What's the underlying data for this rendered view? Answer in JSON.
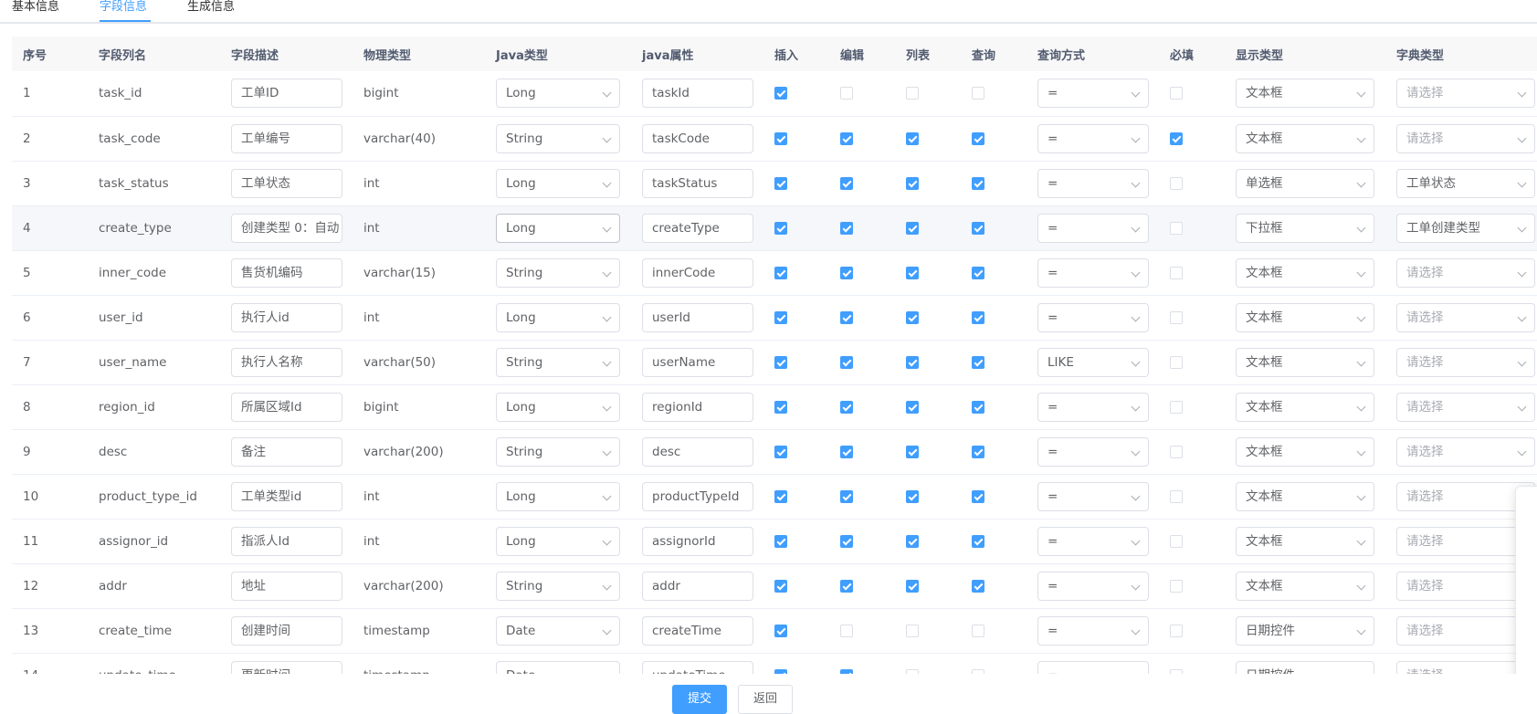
{
  "tabs": [
    "基本信息",
    "字段信息",
    "生成信息"
  ],
  "columns": [
    "序号",
    "字段列名",
    "字段描述",
    "物理类型",
    "Java类型",
    "java属性",
    "插入",
    "编辑",
    "列表",
    "查询",
    "查询方式",
    "必填",
    "显示类型",
    "字典类型"
  ],
  "dict_placeholder": "请选择",
  "rows": [
    {
      "no": "1",
      "col": "task_id",
      "desc": "工单ID",
      "ptype": "bigint",
      "jtype": "Long",
      "jprop": "taskId",
      "ins": true,
      "edit": false,
      "list": false,
      "query": false,
      "qtype": "=",
      "req": false,
      "html": "文本框",
      "dict": ""
    },
    {
      "no": "2",
      "col": "task_code",
      "desc": "工单编号",
      "ptype": "varchar(40)",
      "jtype": "String",
      "jprop": "taskCode",
      "ins": true,
      "edit": true,
      "list": true,
      "query": true,
      "qtype": "=",
      "req": true,
      "html": "文本框",
      "dict": ""
    },
    {
      "no": "3",
      "col": "task_status",
      "desc": "工单状态",
      "ptype": "int",
      "jtype": "Long",
      "jprop": "taskStatus",
      "ins": true,
      "edit": true,
      "list": true,
      "query": true,
      "qtype": "=",
      "req": false,
      "html": "单选框",
      "dict": "工单状态"
    },
    {
      "no": "4",
      "col": "create_type",
      "desc": "创建类型 0：自动",
      "ptype": "int",
      "jtype": "Long",
      "jprop": "createType",
      "ins": true,
      "edit": true,
      "list": true,
      "query": true,
      "qtype": "=",
      "req": false,
      "html": "下拉框",
      "dict": "工单创建类型"
    },
    {
      "no": "5",
      "col": "inner_code",
      "desc": "售货机编码",
      "ptype": "varchar(15)",
      "jtype": "String",
      "jprop": "innerCode",
      "ins": true,
      "edit": true,
      "list": true,
      "query": true,
      "qtype": "=",
      "req": false,
      "html": "文本框",
      "dict": ""
    },
    {
      "no": "6",
      "col": "user_id",
      "desc": "执行人id",
      "ptype": "int",
      "jtype": "Long",
      "jprop": "userId",
      "ins": true,
      "edit": true,
      "list": true,
      "query": true,
      "qtype": "=",
      "req": false,
      "html": "文本框",
      "dict": ""
    },
    {
      "no": "7",
      "col": "user_name",
      "desc": "执行人名称",
      "ptype": "varchar(50)",
      "jtype": "String",
      "jprop": "userName",
      "ins": true,
      "edit": true,
      "list": true,
      "query": true,
      "qtype": "LIKE",
      "req": false,
      "html": "文本框",
      "dict": ""
    },
    {
      "no": "8",
      "col": "region_id",
      "desc": "所属区域Id",
      "ptype": "bigint",
      "jtype": "Long",
      "jprop": "regionId",
      "ins": true,
      "edit": true,
      "list": true,
      "query": true,
      "qtype": "=",
      "req": false,
      "html": "文本框",
      "dict": ""
    },
    {
      "no": "9",
      "col": "desc",
      "desc": "备注",
      "ptype": "varchar(200)",
      "jtype": "String",
      "jprop": "desc",
      "ins": true,
      "edit": true,
      "list": true,
      "query": true,
      "qtype": "=",
      "req": false,
      "html": "文本框",
      "dict": ""
    },
    {
      "no": "10",
      "col": "product_type_id",
      "desc": "工单类型id",
      "ptype": "int",
      "jtype": "Long",
      "jprop": "productTypeId",
      "ins": true,
      "edit": true,
      "list": true,
      "query": true,
      "qtype": "=",
      "req": false,
      "html": "文本框",
      "dict": ""
    },
    {
      "no": "11",
      "col": "assignor_id",
      "desc": "指派人Id",
      "ptype": "int",
      "jtype": "Long",
      "jprop": "assignorId",
      "ins": true,
      "edit": true,
      "list": true,
      "query": true,
      "qtype": "=",
      "req": false,
      "html": "文本框",
      "dict": ""
    },
    {
      "no": "12",
      "col": "addr",
      "desc": "地址",
      "ptype": "varchar(200)",
      "jtype": "String",
      "jprop": "addr",
      "ins": true,
      "edit": true,
      "list": true,
      "query": true,
      "qtype": "=",
      "req": false,
      "html": "文本框",
      "dict": ""
    },
    {
      "no": "13",
      "col": "create_time",
      "desc": "创建时间",
      "ptype": "timestamp",
      "jtype": "Date",
      "jprop": "createTime",
      "ins": true,
      "edit": false,
      "list": false,
      "query": false,
      "qtype": "=",
      "req": false,
      "html": "日期控件",
      "dict": ""
    },
    {
      "no": "14",
      "col": "update_time",
      "desc": "更新时间",
      "ptype": "timestamp",
      "jtype": "Date",
      "jprop": "updateTime",
      "ins": true,
      "edit": true,
      "list": false,
      "query": false,
      "qtype": "=",
      "req": false,
      "html": "日期控件",
      "dict": ""
    }
  ],
  "footer": {
    "submit": "提交",
    "back": "返回"
  },
  "colors": {
    "primary": "#409eff",
    "border": "#dcdfe6",
    "header_bg": "#f8f8f9"
  }
}
